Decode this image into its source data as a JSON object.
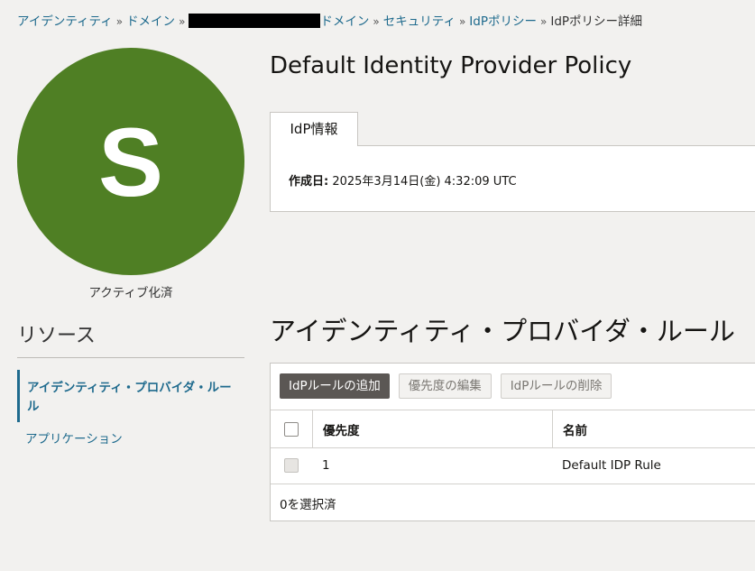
{
  "breadcrumb": {
    "items": [
      "アイデンティティ",
      "ドメイン",
      "ドメイン",
      "セキュリティ",
      "IdPポリシー"
    ],
    "current": "IdPポリシー詳細",
    "separator": "»"
  },
  "avatar": {
    "letter": "S",
    "color": "#4f7f24",
    "status": "アクティブ化済"
  },
  "resources": {
    "title": "リソース",
    "items": [
      "アイデンティティ・プロバイダ・ルール",
      "アプリケーション"
    ]
  },
  "page": {
    "title": "Default Identity Provider Policy"
  },
  "tabs": [
    {
      "label": "IdP情報"
    }
  ],
  "info": {
    "created_label": "作成日:",
    "created_value": "2025年3月14日(金) 4:32:09 UTC"
  },
  "rules_section": {
    "title": "アイデンティティ・プロバイダ・ルール",
    "buttons": {
      "add": "IdPルールの追加",
      "edit_priority": "優先度の編集",
      "delete": "IdPルールの削除"
    },
    "columns": [
      "優先度",
      "名前"
    ],
    "rows": [
      {
        "priority": "1",
        "name": "Default IDP Rule"
      }
    ],
    "selection": "0を選択済"
  }
}
